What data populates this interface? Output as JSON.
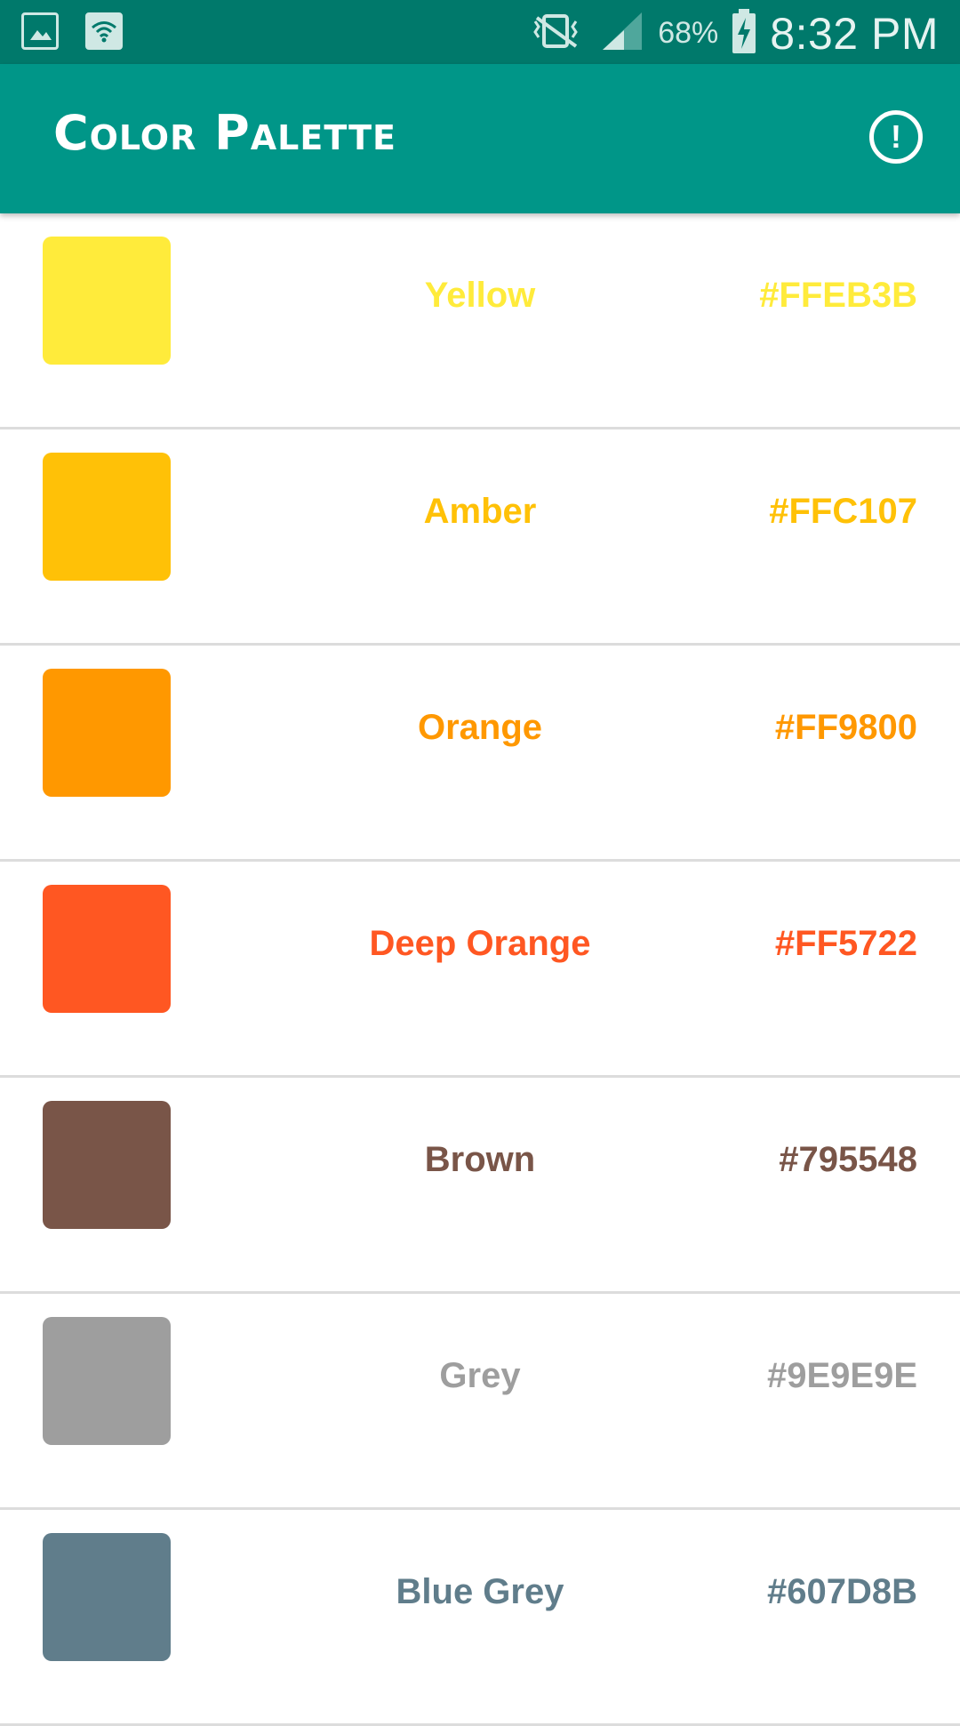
{
  "status_bar": {
    "battery": "68%",
    "time": "8:32 PM",
    "icons": [
      "image-icon",
      "wifi-icon",
      "vibrate-mute-icon",
      "signal-icon",
      "battery-charging-icon"
    ]
  },
  "app_bar": {
    "title": "Color Palette",
    "info_icon_glyph": "!",
    "info_icon": "info-icon"
  },
  "colors": [
    {
      "name": "Yellow",
      "hex": "#FFEB3B",
      "color": "#FFEB3B"
    },
    {
      "name": "Amber",
      "hex": "#FFC107",
      "color": "#FFC107"
    },
    {
      "name": "Orange",
      "hex": "#FF9800",
      "color": "#FF9800"
    },
    {
      "name": "Deep Orange",
      "hex": "#FF5722",
      "color": "#FF5722"
    },
    {
      "name": "Brown",
      "hex": "#795548",
      "color": "#795548"
    },
    {
      "name": "Grey",
      "hex": "#9E9E9E",
      "color": "#9E9E9E"
    },
    {
      "name": "Blue Grey",
      "hex": "#607D8B",
      "color": "#607D8B"
    }
  ],
  "theme": {
    "status_bar_color": "#00796B",
    "app_bar_color": "#009688"
  }
}
